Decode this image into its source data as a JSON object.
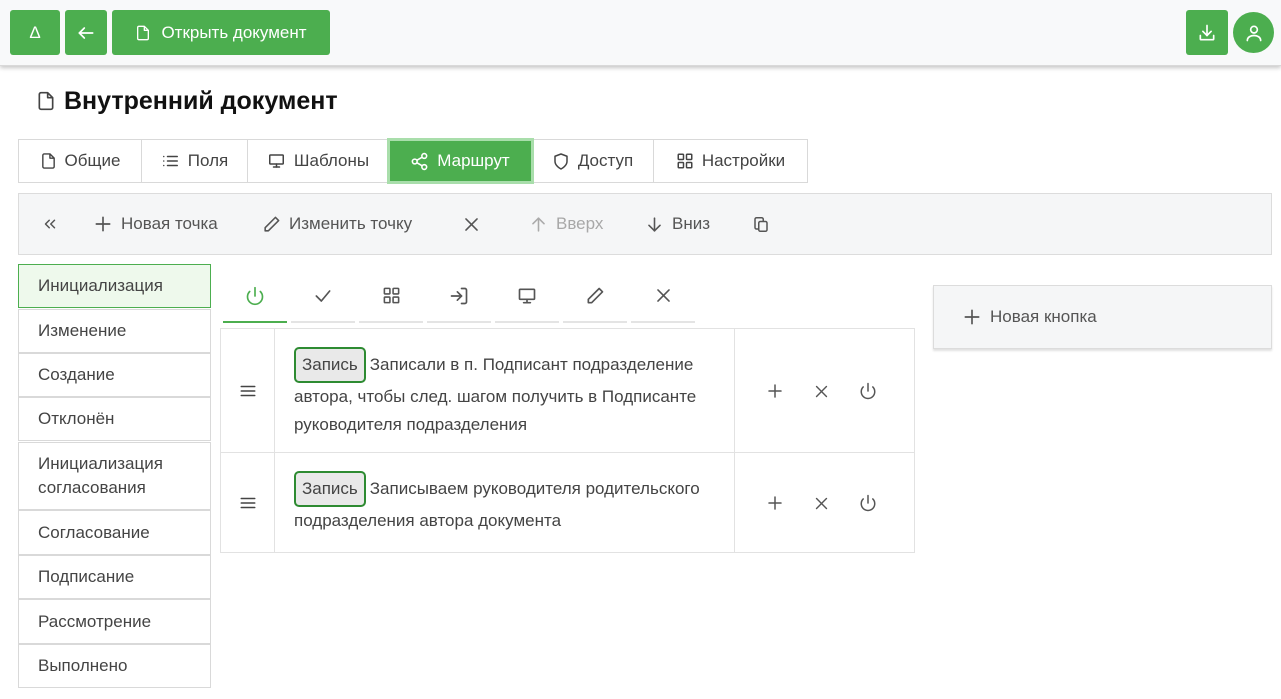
{
  "topbar": {
    "home_label": "Δ",
    "open_doc_label": "Открыть документ",
    "icons": [
      "arrow-left-icon",
      "file-icon",
      "download-icon",
      "user-icon"
    ],
    "accent": "#4cae4f"
  },
  "page": {
    "title": "Внутренний документ"
  },
  "tabs": [
    {
      "label": "Общие",
      "icon": "file-icon"
    },
    {
      "label": "Поля",
      "icon": "list-icon"
    },
    {
      "label": "Шаблоны",
      "icon": "monitor-icon"
    },
    {
      "label": "Маршрут",
      "icon": "share-icon",
      "active": true
    },
    {
      "label": "Доступ",
      "icon": "shield-icon"
    },
    {
      "label": "Настройки",
      "icon": "grid-icon"
    }
  ],
  "toolbar": {
    "new_point": "Новая точка",
    "edit_point": "Изменить точку",
    "up": "Вверх",
    "down": "Вниз"
  },
  "states": [
    "Инициализация",
    "Изменение",
    "Создание",
    "Отклонён",
    "Инициализация согласования",
    "Согласование",
    "Подписание",
    "Рассмотрение",
    "Выполнено"
  ],
  "active_state": "Инициализация",
  "icon_tabs": [
    "power-icon",
    "check-icon",
    "grid-icon",
    "login-icon",
    "monitor-icon",
    "pencil-icon",
    "close-icon"
  ],
  "rows": [
    {
      "badge": "Запись",
      "text": "Записали в п. Подписант подразделение автора, чтобы след. шагом получить в Подписанте руководителя подразделения"
    },
    {
      "badge": "Запись",
      "text": "Записываем руководителя родительского подразделения автора документа"
    }
  ],
  "side_panel": {
    "new_button_label": "Новая кнопка"
  }
}
